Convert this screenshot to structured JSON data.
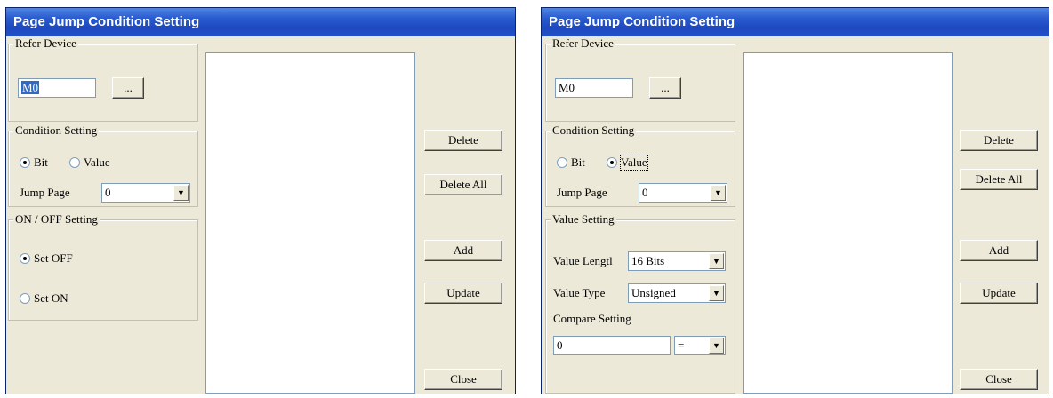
{
  "left": {
    "title": "Page Jump Condition Setting",
    "refer": {
      "label": "Refer Device",
      "device": "M0",
      "browse": "..."
    },
    "condition": {
      "label": "Condition Setting",
      "bit": "Bit",
      "value": "Value",
      "jump_page_label": "Jump Page",
      "jump_page": "0"
    },
    "onoff": {
      "label": "ON / OFF Setting",
      "set_off": "Set OFF",
      "set_on": "Set ON"
    },
    "buttons": {
      "delete": "Delete",
      "delete_all": "Delete All",
      "add": "Add",
      "update": "Update",
      "close": "Close"
    }
  },
  "right": {
    "title": "Page Jump Condition Setting",
    "refer": {
      "label": "Refer Device",
      "device": "M0",
      "browse": "..."
    },
    "condition": {
      "label": "Condition Setting",
      "bit": "Bit",
      "value": "Value",
      "jump_page_label": "Jump Page",
      "jump_page": "0"
    },
    "value_setting": {
      "label": "Value Setting",
      "length_label": "Value Lengtl",
      "length": "16 Bits",
      "type_label": "Value Type",
      "type": "Unsigned",
      "compare_label": "Compare Setting",
      "compare_value": "0",
      "compare_op": "="
    },
    "buttons": {
      "delete": "Delete",
      "delete_all": "Delete All",
      "add": "Add",
      "update": "Update",
      "close": "Close"
    }
  },
  "colors": {
    "title_bar": "#2a5cd0",
    "dialog_bg": "#ece9d8",
    "selection": "#316ac5"
  },
  "icons": {
    "dropdown": "chevron-down-icon"
  }
}
